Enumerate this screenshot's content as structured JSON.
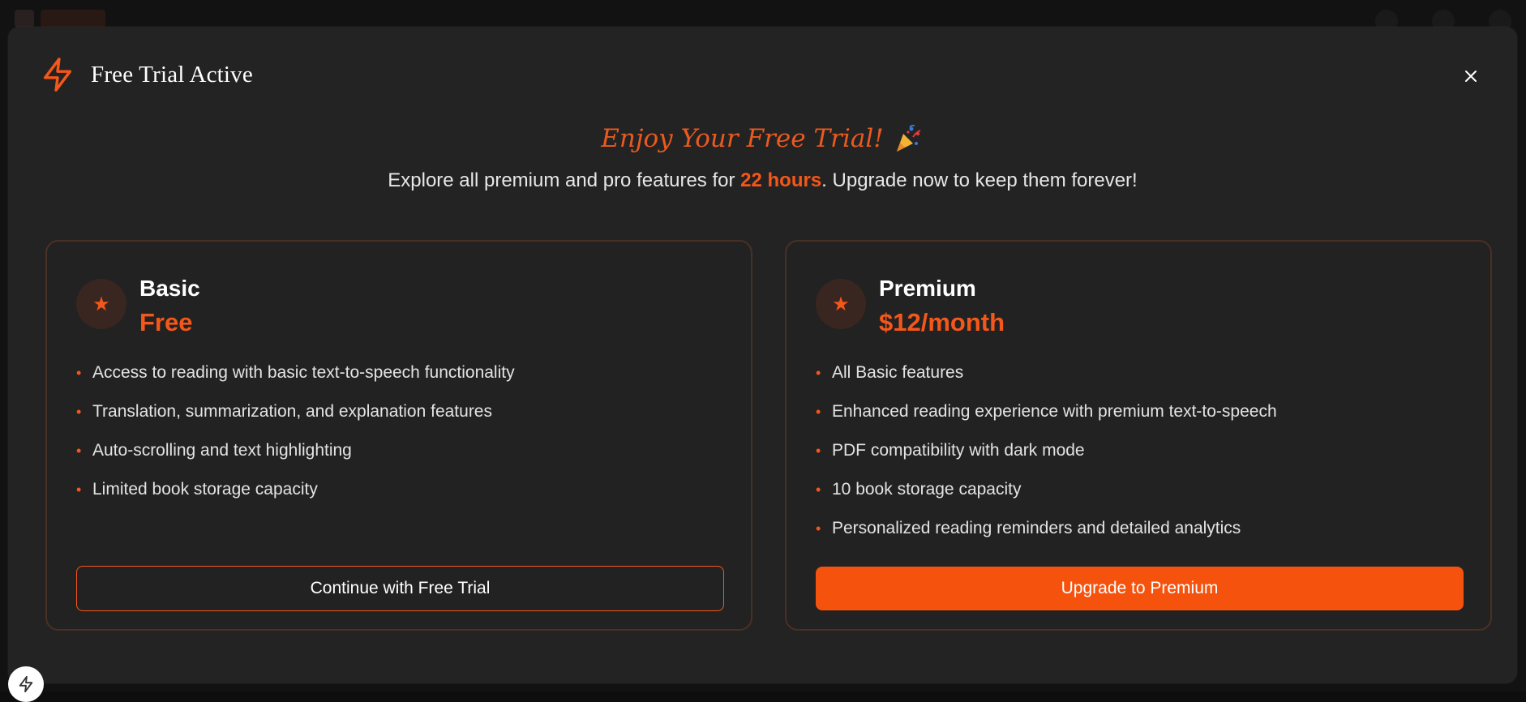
{
  "modal": {
    "title": "Free Trial Active",
    "close_label": "×"
  },
  "hero": {
    "title": "Enjoy Your Free Trial!",
    "subtitle_before": "Explore all premium and pro features for ",
    "subtitle_highlight": "22 hours",
    "subtitle_after": ". Upgrade now to keep them forever!"
  },
  "plans": [
    {
      "name": "Basic",
      "price": "Free",
      "features": [
        "Access to reading with basic text-to-speech functionality",
        "Translation, summarization, and explanation features",
        "Auto-scrolling and text highlighting",
        "Limited book storage capacity"
      ],
      "button_label": "Continue with Free Trial"
    },
    {
      "name": "Premium",
      "price": "$12/month",
      "features": [
        "All Basic features",
        "Enhanced reading experience with premium text-to-speech",
        "PDF compatibility with dark mode",
        "10 book storage capacity",
        "Personalized reading reminders and detailed analytics"
      ],
      "button_label": "Upgrade to Premium"
    }
  ],
  "icons": {
    "header": "bolt-icon",
    "close": "close-icon",
    "hero": "party-popper-icon",
    "plan": "star-icon",
    "bullet": "bullet-dot-icon",
    "floating": "bolt-icon"
  },
  "colors": {
    "accent": "#f4571a",
    "modal_bg": "#232323",
    "card_border": "#4a3024",
    "star_badge_bg": "#3a2620"
  }
}
